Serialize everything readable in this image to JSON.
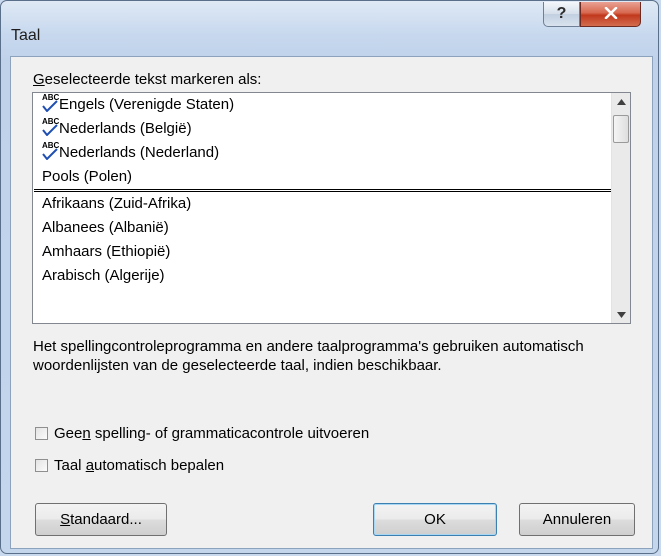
{
  "window": {
    "title": "Taal",
    "help_label": "?",
    "close_label": "x"
  },
  "list": {
    "label_prefix": "G",
    "label_rest": "eselecteerde tekst markeren als:",
    "recent": [
      {
        "label": "Engels (Verenigde Staten)",
        "spellcheck_icon": true
      },
      {
        "label": "Nederlands (België)",
        "spellcheck_icon": true
      },
      {
        "label": "Nederlands (Nederland)",
        "spellcheck_icon": true
      },
      {
        "label": "Pools (Polen)",
        "spellcheck_icon": false
      }
    ],
    "all": [
      {
        "label": "Afrikaans (Zuid-Afrika)"
      },
      {
        "label": "Albanees (Albanië)"
      },
      {
        "label": "Amhaars (Ethiopië)"
      },
      {
        "label": "Arabisch (Algerije)"
      }
    ],
    "abc_text": "ABC"
  },
  "description": "Het spellingcontroleprogramma en andere taalprogramma's gebruiken automatisch woordenlijsten van de geselecteerde taal, indien beschikbaar.",
  "options": {
    "no_proofing": {
      "pre": "Gee",
      "u": "n",
      "post": " spelling- of grammaticacontrole uitvoeren",
      "checked": false
    },
    "detect_language": {
      "pre": "Taal ",
      "u": "a",
      "post": "utomatisch bepalen",
      "checked": false
    }
  },
  "buttons": {
    "default": {
      "u": "S",
      "rest": "tandaard..."
    },
    "ok": "OK",
    "cancel": "Annuleren"
  },
  "icons": {
    "help": "help-icon",
    "close": "close-icon",
    "spellcheck": "spellcheck-abc-icon"
  }
}
